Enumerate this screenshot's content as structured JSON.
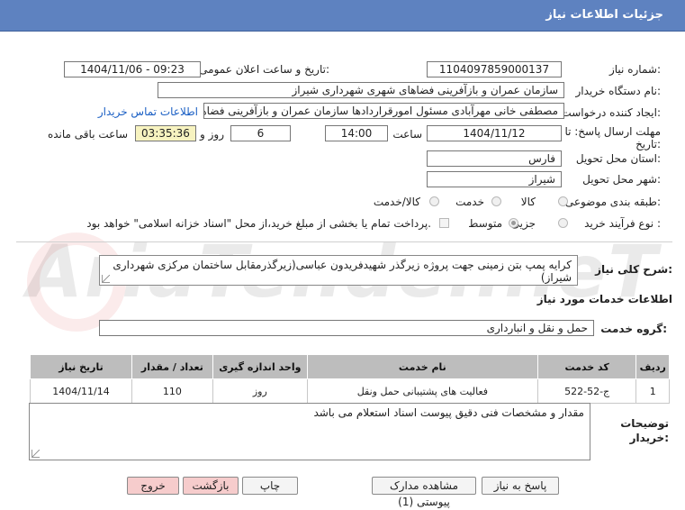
{
  "page": {
    "title": "جزئیات اطلاعات نیاز"
  },
  "info": {
    "need_number_label": "شماره نیاز:",
    "need_number": "1104097859000137",
    "announce_label": "تاریخ و ساعت اعلان عمومی:",
    "announce_value": "1404/11/06 - 09:23",
    "buyer_org_label": "نام دستگاه خریدار:",
    "buyer_org": "سازمان عمران و بازآفرینی فضاهای شهری شهرداری شیراز",
    "creator_label": "ایجاد کننده درخواست:",
    "creator": "مصطفی خانی مهرآبادی مسئول امورقراردادها سازمان عمران و بازآفرینی فضاهای",
    "contact_link": "اطلاعات تماس خریدار",
    "deadline_label": "مهلت ارسال پاسخ: تا",
    "deadline_label2": "تاریخ:",
    "deadline_date": "1404/11/12",
    "time_label": "ساعت",
    "deadline_time": "14:00",
    "days_value": "6",
    "days_label": "روز و",
    "remaining_time": "03:35:36",
    "remaining_label": "ساعت باقی مانده",
    "province_label": "استان محل تحویل:",
    "province": "فارس",
    "city_label": "شهر محل تحویل:",
    "city": "شیراز",
    "category_label": "طبقه بندی موضوعی:",
    "category_options": [
      "کالا",
      "خدمت",
      "کالا/خدمت"
    ],
    "purchase_type_label": "نوع فرآیند خرید :",
    "purchase_options": [
      "جزیی",
      "متوسط"
    ],
    "payment_note": "پرداخت تمام یا بخشی از مبلغ خرید،از محل \"اسناد خزانه اسلامی\" خواهد بود."
  },
  "description": {
    "label": "شرح کلی نیاز:",
    "text": "کرایه پمپ بتن زمینی جهت پروژه زیرگذر شهیدفریدون عباسی(زیرگذرمقابل ساختمان مرکزی شهرداری شیراز)"
  },
  "services": {
    "section_title": "اطلاعات خدمات مورد نیاز",
    "group_label": "گروه خدمت:",
    "group_value": "حمل و نقل و انبارداری",
    "columns": [
      "ردیف",
      "کد خدمت",
      "نام خدمت",
      "واحد اندازه گیری",
      "تعداد / مقدار",
      "تاریخ نیاز"
    ],
    "rows": [
      {
        "row": "1",
        "code": "ج-52-522",
        "name": "فعالیت های پشتیبانی حمل ونقل",
        "unit": "روز",
        "qty": "110",
        "date": "1404/11/14"
      }
    ]
  },
  "buyer_notes": {
    "label_line1": "توضیحات",
    "label_line2": "خریدار:",
    "text": "مقدار و مشخصات فنی دقیق پیوست اسناد استعلام می باشد"
  },
  "buttons": {
    "reply": "پاسخ به نیاز",
    "attachments": "مشاهده مدارک پیوستی (1)",
    "print": "چاپ",
    "back": "بازگشت",
    "exit": "خروج"
  },
  "watermark": {
    "text": "AriaTender.neT"
  },
  "colors": {
    "header": "#5e82c0",
    "yellow_box": "#f7f3c0",
    "pink_button": "#f6cccc",
    "link": "#1a5fc4"
  }
}
